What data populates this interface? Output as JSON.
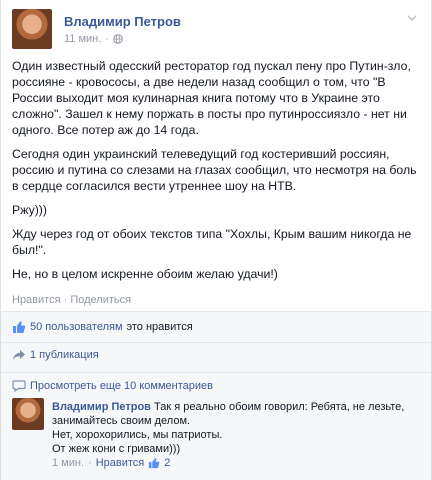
{
  "post": {
    "author": "Владимир Петров",
    "time": "11 мин.",
    "paragraphs": [
      "Один известный одесский ресторатор год пускал пену про Путин-зло, россияне - кровососы, а две недели назад сообщил о том, что \"В России выходит моя кулинарная книга потому что в Украине это сложно\". Зашел к нему поржать в посты про путинроссиязло - нет ни одного. Все потер аж до 14 года.",
      "Сегодня один украинский телеведущий год костеривший россиян, россию и путина со слезами на глазах сообщил, что несмотря на боль в сердце согласился вести утреннее шоу на НТВ.",
      "Ржу)))",
      "Жду через год от обоих текстов типа \"Хохлы, Крым вашим никогда не был!\".",
      "Не, но в целом искренне обоим желаю удачи!)"
    ],
    "actions": {
      "like": "Нравится",
      "separator": "·",
      "share": "Поделиться"
    }
  },
  "likes": {
    "count": "50 пользователям",
    "rest": "это нравится"
  },
  "shares": {
    "label": "1 публикация"
  },
  "more_comments": {
    "label": "Просмотреть еще 10 комментариев"
  },
  "comment": {
    "author": "Владимир Петров",
    "lines": [
      "Так я реально обоим говорил: Ребята, не лезьте,",
      "занимайтесь своим делом.",
      "Нет, хорохорились, мы патриоты.",
      "От жеж кони с гривами)))"
    ],
    "time": "1 мин.",
    "separator": "·",
    "like": "Нравится",
    "like_count": "2"
  },
  "colors": {
    "link": "#3b5998",
    "muted": "#9197a3",
    "text": "#141823"
  },
  "icons": {
    "privacy": "globe-icon",
    "menu": "chevron-down-icon",
    "like": "thumbs-up-icon",
    "share": "share-arrow-icon",
    "comments": "speech-bubble-icon"
  }
}
